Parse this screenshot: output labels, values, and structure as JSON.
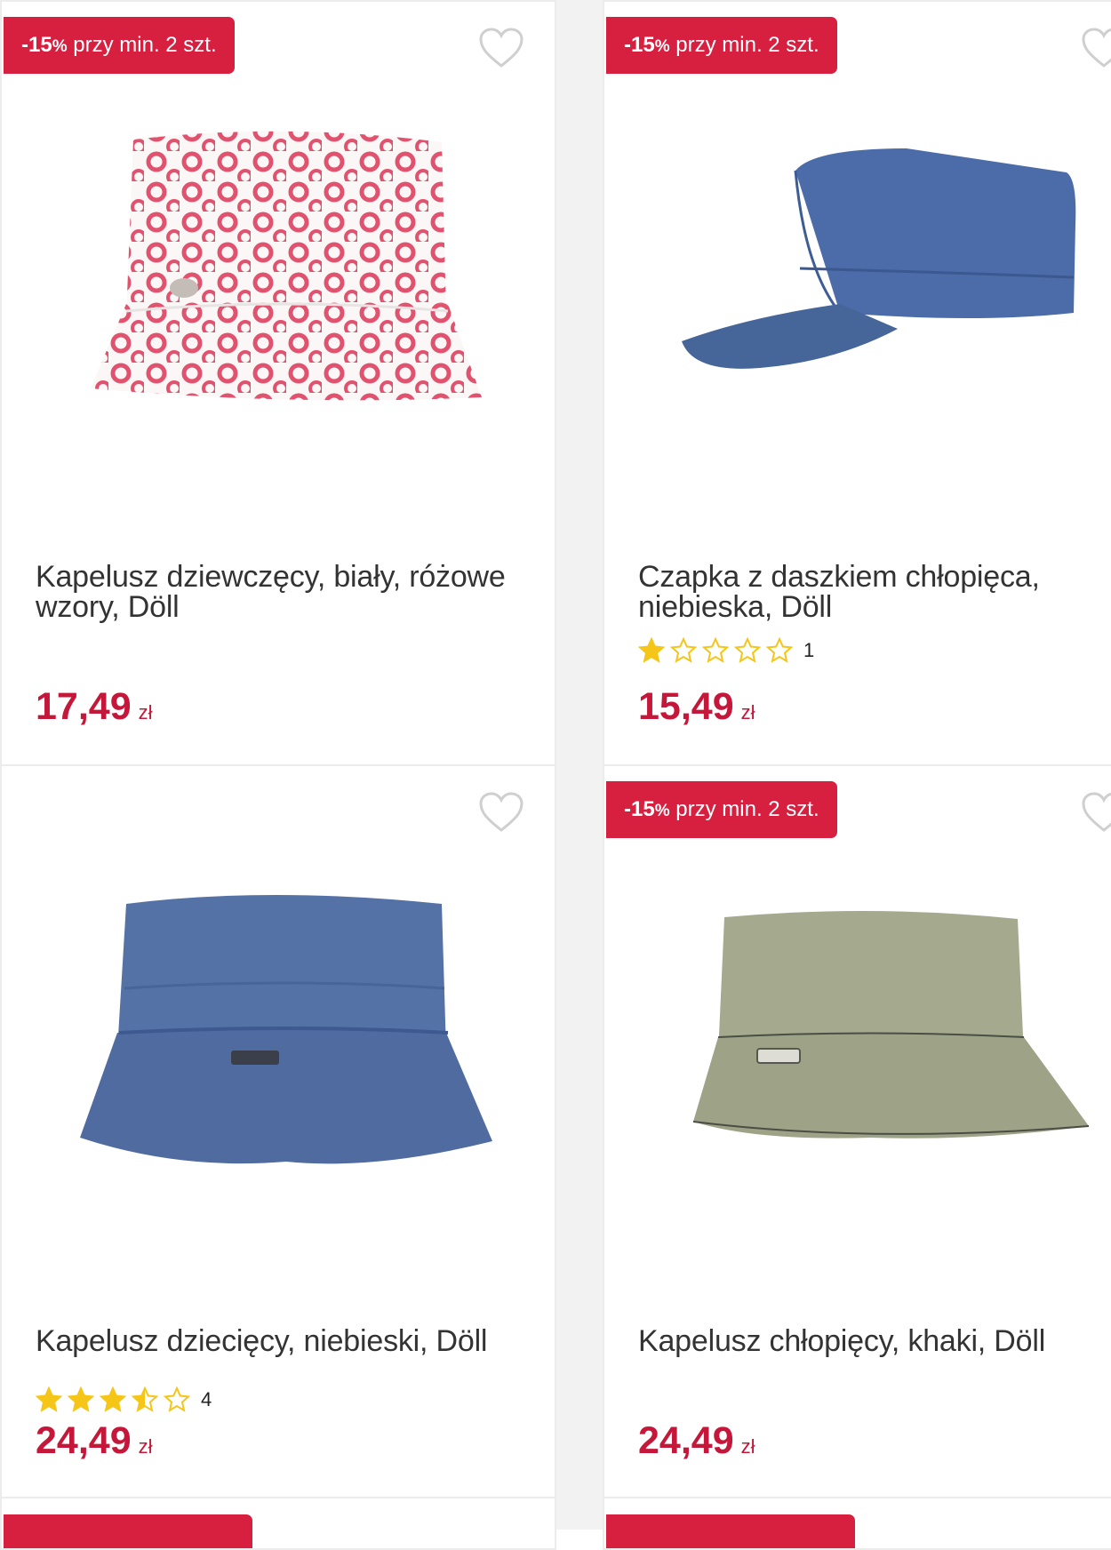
{
  "products": [
    {
      "badge": {
        "discount": "-15",
        "pct": "%",
        "text": " przy min. 2 szt."
      },
      "title": "Kapelusz dziewczęcy, biały, różowe wzory, Döll",
      "price": "17,49",
      "currency": "zł",
      "rating": null,
      "review_count": null
    },
    {
      "badge": {
        "discount": "-15",
        "pct": "%",
        "text": " przy min. 2 szt."
      },
      "title": "Czapka z daszkiem chłopięca, niebieska, Döll",
      "price": "15,49",
      "currency": "zł",
      "rating": 1,
      "review_count": "1"
    },
    {
      "badge": null,
      "title": "Kapelusz dziecięcy, niebieski, Döll",
      "price": "24,49",
      "currency": "zł",
      "rating": 3.5,
      "review_count": "4"
    },
    {
      "badge": {
        "discount": "-15",
        "pct": "%",
        "text": " przy min. 2 szt."
      },
      "title": "Kapelusz chłopięcy, khaki, Döll",
      "price": "24,49",
      "currency": "zł",
      "rating": null,
      "review_count": null
    }
  ],
  "colors": {
    "accent": "#d71f3f",
    "price": "#c5173a",
    "star": "#f5c518",
    "hat_blue": "#4b6ca8",
    "hat_khaki": "#a3a78c",
    "hat_pink": "#e0526e"
  },
  "icons": {
    "favorite": "heart-outline-icon",
    "star_full": "star-filled-icon",
    "star_empty": "star-outline-icon",
    "star_half": "star-half-icon"
  }
}
